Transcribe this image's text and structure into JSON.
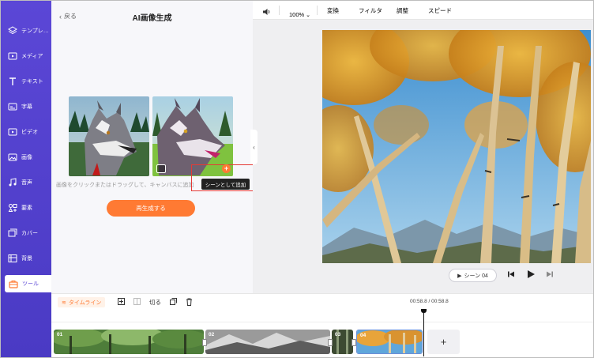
{
  "sidebar": {
    "items": [
      {
        "label": "テンプレ…",
        "icon": "layers-icon"
      },
      {
        "label": "メディア",
        "icon": "media-icon"
      },
      {
        "label": "テキスト",
        "icon": "text-icon"
      },
      {
        "label": "字幕",
        "icon": "subtitle-icon"
      },
      {
        "label": "ビデオ",
        "icon": "video-icon"
      },
      {
        "label": "画像",
        "icon": "image-icon"
      },
      {
        "label": "音声",
        "icon": "music-icon"
      },
      {
        "label": "要素",
        "icon": "elements-icon"
      },
      {
        "label": "カバー",
        "icon": "cover-icon"
      },
      {
        "label": "背景",
        "icon": "background-icon"
      },
      {
        "label": "ツール",
        "icon": "toolbox-icon"
      }
    ]
  },
  "panel": {
    "back_label": "戻る",
    "title": "AI画像生成",
    "hint": "画像をクリックまたはドラッグして、キャンバスに追加",
    "regenerate_label": "再生成する",
    "tooltip": "シーンとして追加",
    "plus": "+"
  },
  "toolbar": {
    "zoom": "100%",
    "transform": "変換",
    "filter": "フィルタ",
    "adjust": "調整",
    "speed": "スピード"
  },
  "player": {
    "scene_label": "シーン 04"
  },
  "timeline": {
    "label": "タイムライン",
    "cut_label": "切る",
    "timecode": "00:58.8 / 00:58.8",
    "clips": [
      {
        "num": "01"
      },
      {
        "num": "02"
      },
      {
        "num": "03"
      },
      {
        "num": "04"
      }
    ],
    "add": "+"
  },
  "colors": {
    "sidebar": "#5b47d6",
    "accent": "#ff7a33",
    "highlight_box": "#e53935"
  }
}
